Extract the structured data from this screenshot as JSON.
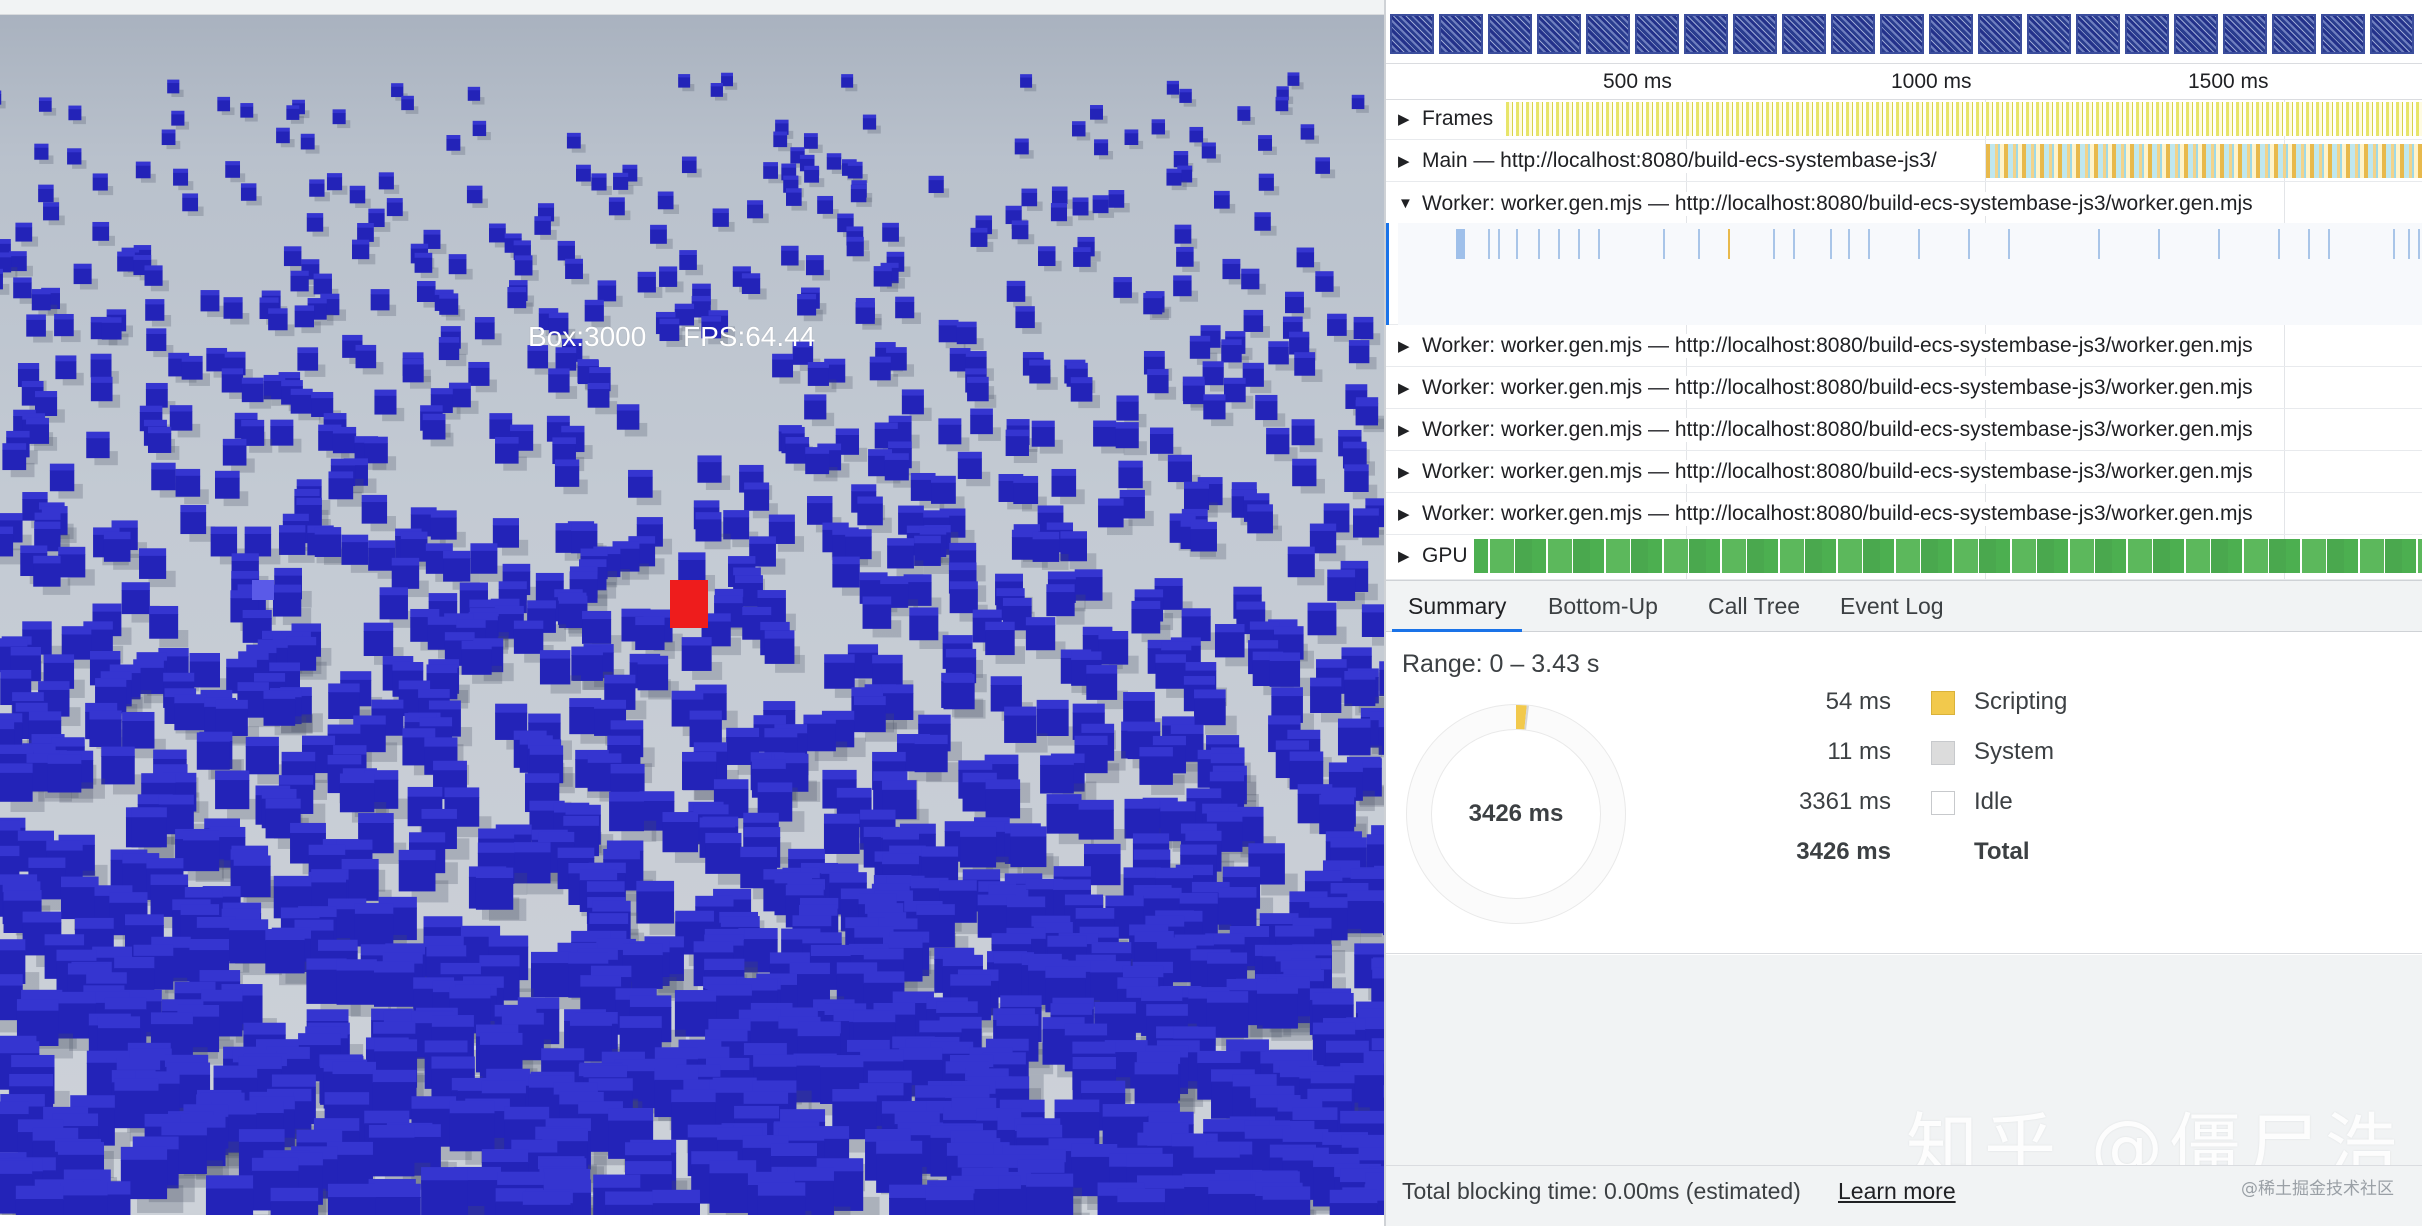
{
  "scene": {
    "box_count_label": "Box:3000",
    "fps_label": "FPS:64.44",
    "colors": {
      "ground": "#c9ced6",
      "cube": "#2323b8",
      "cube_top": "#3535d0",
      "target": "#ee1c1c"
    }
  },
  "timeline": {
    "ruler": [
      "500 ms",
      "1000 ms",
      "1500 ms"
    ],
    "tracks": {
      "frames": "Frames",
      "main": "Main — http://localhost:8080/build-ecs-systembase-js3/",
      "worker": "Worker: worker.gen.mjs — http://localhost:8080/build-ecs-systembase-js3/worker.gen.mjs",
      "gpu": "GPU"
    },
    "expand_collapsed": "▶",
    "expand_open": "▼"
  },
  "tabs": [
    "Summary",
    "Bottom-Up",
    "Call Tree",
    "Event Log"
  ],
  "summary": {
    "range": "Range: 0 – 3.43 s",
    "donut_total": "3426 ms",
    "rows": [
      {
        "value": "54 ms",
        "name": "Scripting",
        "color": "#f2c94c"
      },
      {
        "value": "11 ms",
        "name": "System",
        "color": "#dcdcdc"
      },
      {
        "value": "3361 ms",
        "name": "Idle",
        "color": "#ffffff"
      },
      {
        "value": "3426 ms",
        "name": "Total",
        "color": ""
      }
    ]
  },
  "footer": {
    "text": "Total blocking time: 0.00ms (estimated)",
    "link": "Learn more",
    "credit": "@稀土掘金技术社区"
  },
  "watermark": "知乎 @僵尸浩"
}
